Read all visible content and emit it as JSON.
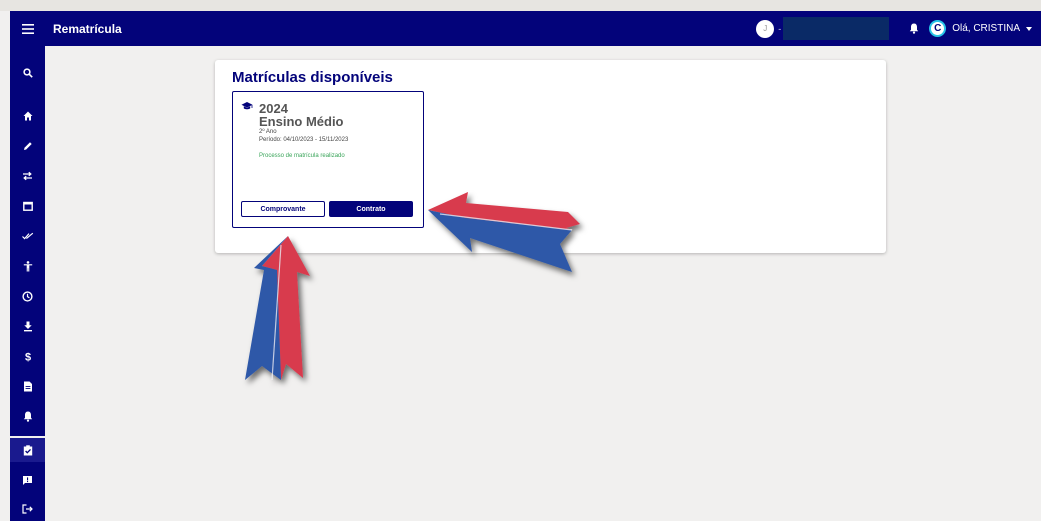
{
  "app": {
    "title": "Rematrícula",
    "school_initial": "J",
    "separator": "-",
    "user_initial": "C",
    "greeting": "Olá, CRISTINA"
  },
  "sidebar": {
    "items": [
      {
        "icon": "search-icon"
      },
      {
        "icon": "home-icon"
      },
      {
        "icon": "pencil-icon"
      },
      {
        "icon": "swap-icon"
      },
      {
        "icon": "calendar-icon"
      },
      {
        "icon": "double-check-icon"
      },
      {
        "icon": "accessibility-icon"
      },
      {
        "icon": "clock-icon"
      },
      {
        "icon": "download-icon"
      },
      {
        "icon": "dollar-icon"
      },
      {
        "icon": "document-icon"
      },
      {
        "icon": "bell-icon"
      },
      {
        "icon": "clipboard-check-icon",
        "active": true
      },
      {
        "icon": "feedback-icon"
      },
      {
        "icon": "logout-icon"
      }
    ]
  },
  "main": {
    "heading": "Matrículas disponíveis",
    "enrollment": {
      "year": "2024",
      "level": "Ensino Médio",
      "grade": "2º Ano",
      "period": "Período: 04/10/2023 - 15/11/2023",
      "status": "Processo de matrícula realizado",
      "receipt_button": "Comprovante",
      "contract_button": "Contrato"
    }
  },
  "colors": {
    "primary": "#03037a",
    "status_green": "#3aa55a",
    "background": "#f1f0ef",
    "arrow_red": "#d83a4e",
    "arrow_blue": "#2f58a8"
  }
}
